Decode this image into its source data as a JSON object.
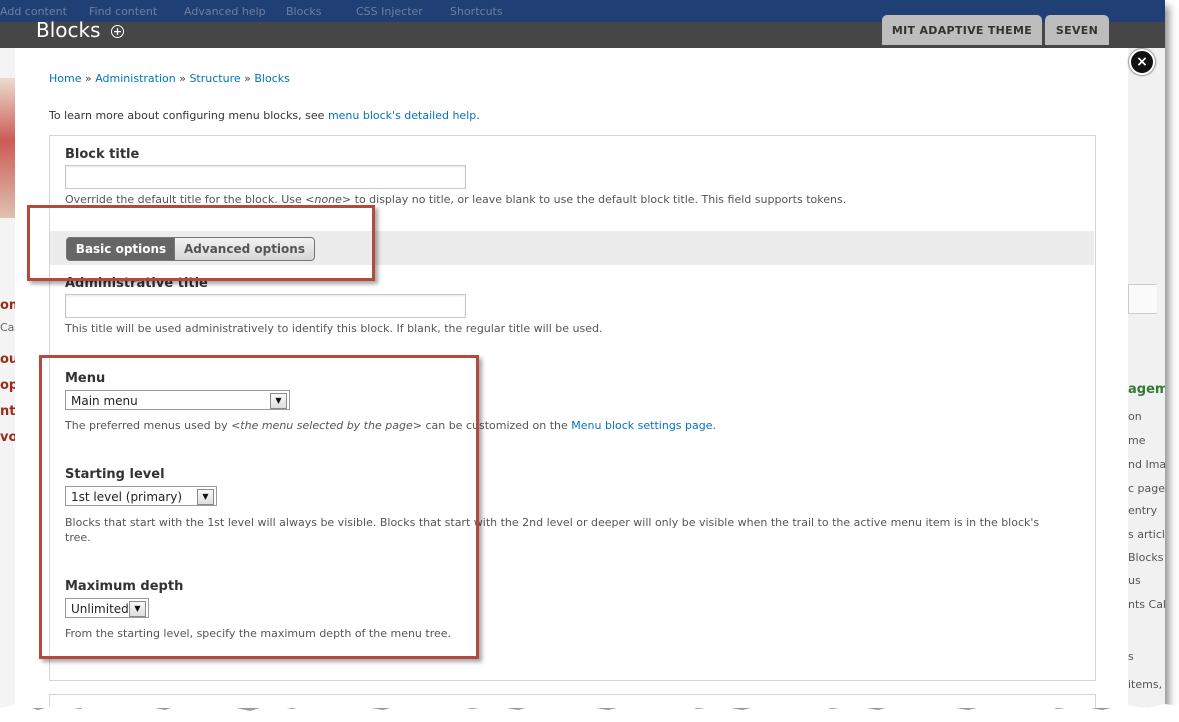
{
  "toolbar": {
    "items": [
      "Add content",
      "Find content",
      "Advanced help",
      "Blocks",
      "CSS Injecter",
      "Shortcuts"
    ]
  },
  "header": {
    "title": "Blocks",
    "add_icon": "plus-circle-icon",
    "theme_tabs": [
      "MIT ADAPTIVE THEME",
      "SEVEN"
    ]
  },
  "background": {
    "left_text": [
      "om",
      "Cal",
      "ou",
      "op",
      "nt",
      "vo"
    ],
    "right_text": [
      "agem",
      "on",
      "me",
      "nd Ima",
      "c page",
      "entry",
      "s articl",
      "Blocks",
      "us",
      "nts Cal",
      "s",
      "items,"
    ]
  },
  "modal": {
    "close_icon": "close-circle-icon",
    "breadcrumb": [
      "Home",
      "Administration",
      "Structure",
      "Blocks"
    ],
    "breadcrumb_sep": "»",
    "intro_text": "To learn more about configuring menu blocks, see",
    "intro_link": "menu block's detailed help",
    "intro_end": ".",
    "block_title": {
      "label": "Block title",
      "value": "",
      "desc_before": "Override the default title for the block. Use",
      "desc_em": "<none>",
      "desc_after": "to display no title, or leave blank to use the default block title. This field supports tokens."
    },
    "tabs": {
      "basic": "Basic options",
      "advanced": "Advanced options"
    },
    "admin_title": {
      "label": "Administrative title",
      "value": "",
      "desc": "This title will be used administratively to identify this block. If blank, the regular title will be used."
    },
    "menu": {
      "label": "Menu",
      "value": "Main menu",
      "desc_before": "The preferred menus used by",
      "desc_em": "<the menu selected by the page>",
      "desc_mid": "can be customized on the",
      "desc_link": "Menu block settings page",
      "desc_after": "."
    },
    "starting_level": {
      "label": "Starting level",
      "value": "1st level (primary)",
      "desc_line1": "Blocks that start with the 1st level will always be visible. Blocks that start with the 2nd level or deeper will only be visible when the trail to the active menu item is in the block's",
      "desc_line2": "tree."
    },
    "maximum_depth": {
      "label": "Maximum depth",
      "value": "Unlimited",
      "desc": "From the starting level, specify the maximum depth of the menu tree."
    }
  },
  "colors": {
    "toolbar": "#1f3f75",
    "header": "#464646",
    "link": "#0074bd",
    "highlight": "#b24b3e",
    "tab_active": "#666666"
  }
}
